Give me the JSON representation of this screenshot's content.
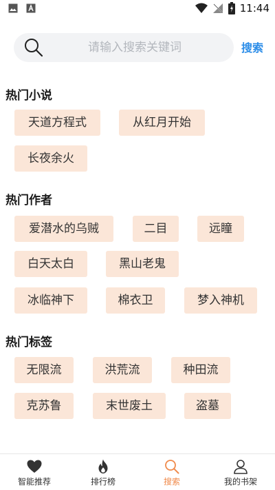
{
  "status_bar": {
    "time": "11:44",
    "icons": [
      "image-icon",
      "text-a-icon",
      "wifi-icon",
      "no-signal-icon",
      "battery-charging-icon"
    ]
  },
  "search": {
    "placeholder": "请输入搜索关键词",
    "value": "",
    "button_label": "搜索"
  },
  "sections": {
    "novels": {
      "title": "热门小说",
      "tags": [
        "天道方程式",
        "从红月开始",
        "长夜余火"
      ]
    },
    "authors": {
      "title": "热门作者",
      "tags": [
        "爱潜水的乌贼",
        "二目",
        "远瞳",
        "白天太白",
        "黑山老鬼",
        "冰临神下",
        "棉衣卫",
        "梦入神机"
      ]
    },
    "labels": {
      "title": "热门标签",
      "tags": [
        "无限流",
        "洪荒流",
        "种田流",
        "克苏鲁",
        "末世废土",
        "盗墓"
      ]
    }
  },
  "bottom_nav": {
    "items": [
      {
        "label": "智能推荐",
        "icon": "heart-icon",
        "active": false
      },
      {
        "label": "排行榜",
        "icon": "flame-icon",
        "active": false
      },
      {
        "label": "搜索",
        "icon": "search-icon",
        "active": true
      },
      {
        "label": "我的书架",
        "icon": "user-icon",
        "active": false
      }
    ]
  },
  "colors": {
    "tag_bg": "#fbe6d8",
    "accent_blue": "#2c8de8",
    "active_orange": "#f08a4b",
    "search_bg": "#f2f3f5"
  }
}
